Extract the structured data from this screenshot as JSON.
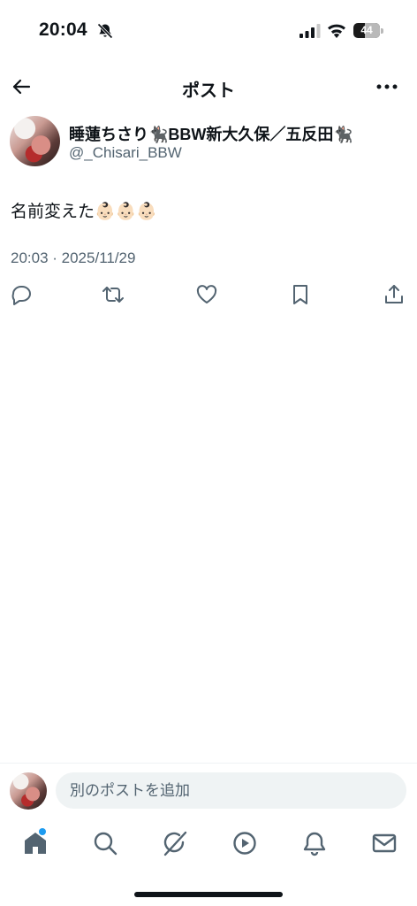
{
  "status_bar": {
    "time": "20:04",
    "battery_level": "44",
    "icons": [
      "bell-off-icon",
      "cellular-signal-icon",
      "wifi-icon",
      "battery-icon"
    ]
  },
  "header": {
    "title": "ポスト",
    "back_icon": "arrow-left-icon",
    "more_icon": "more-horizontal-icon"
  },
  "post": {
    "author": {
      "name": "睡蓮ちさり🐈‍⬛BBW新大久保／五反田🐈‍⬛",
      "handle": "@_Chisari_BBW"
    },
    "text": "名前変えた👶🏻👶🏻👶🏻",
    "timestamp": "20:03 · 2025/11/29",
    "actions": [
      "reply-icon",
      "repost-icon",
      "like-icon",
      "bookmark-icon",
      "share-icon"
    ]
  },
  "composer": {
    "placeholder": "別のポストを追加"
  },
  "tab_bar": {
    "items": [
      "home-icon",
      "search-icon",
      "grok-icon",
      "video-icon",
      "notifications-icon",
      "messages-icon"
    ],
    "home_badge": true
  },
  "colors": {
    "text_primary": "#0f1419",
    "text_secondary": "#536471",
    "input_bg": "#eff3f4",
    "accent": "#1d9bf0"
  }
}
